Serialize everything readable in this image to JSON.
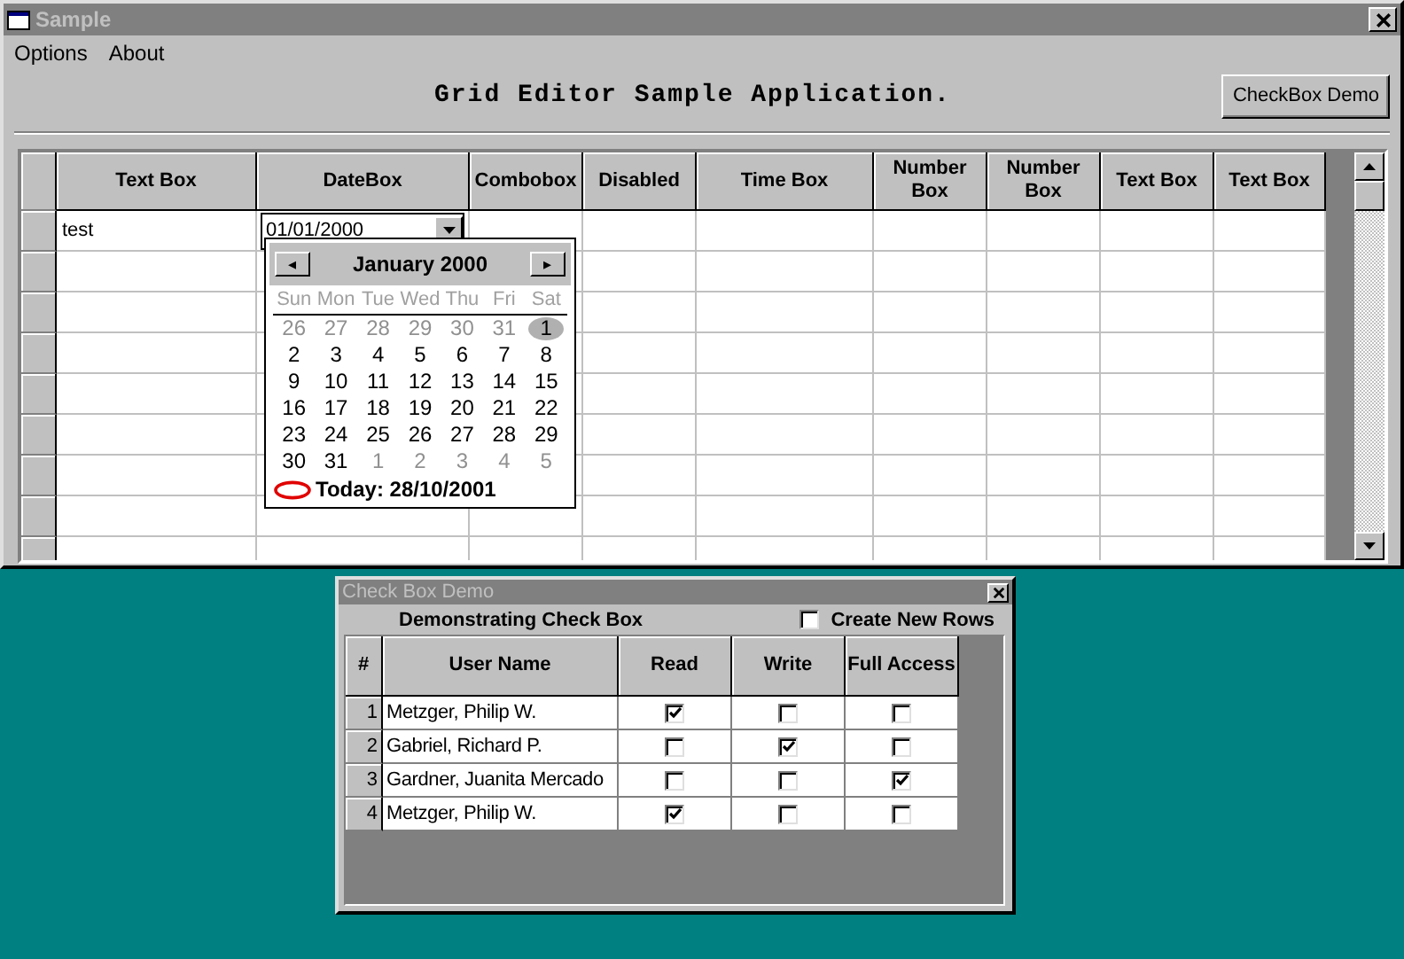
{
  "window": {
    "title": "Sample"
  },
  "menu": [
    {
      "label": "Options"
    },
    {
      "label": "About"
    }
  ],
  "heading": "Grid Editor Sample Application.",
  "checkbox_demo_button": "CheckBox Demo",
  "grid": {
    "columns": [
      "Text Box",
      "DateBox",
      "Combobox",
      "Disabled",
      "Time Box",
      "Number Box",
      "Number Box",
      "Text Box",
      "Text Box"
    ],
    "rows": [
      {
        "cells": [
          {
            "kind": "text",
            "value": "test"
          },
          {
            "kind": "date",
            "value": "01/01/2000"
          }
        ]
      }
    ]
  },
  "calendar": {
    "month": "January 2000",
    "prev": "◂",
    "next": "▸",
    "day_names": [
      "Sun",
      "Mon",
      "Tue",
      "Wed",
      "Thu",
      "Fri",
      "Sat"
    ],
    "weeks": [
      [
        {
          "day": "26",
          "muted": true,
          "selected": false
        },
        {
          "day": "27",
          "muted": true,
          "selected": false
        },
        {
          "day": "28",
          "muted": true,
          "selected": false
        },
        {
          "day": "29",
          "muted": true,
          "selected": false
        },
        {
          "day": "30",
          "muted": true,
          "selected": false
        },
        {
          "day": "31",
          "muted": true,
          "selected": false
        },
        {
          "day": "1",
          "muted": false,
          "selected": true
        }
      ],
      [
        {
          "day": "2",
          "muted": false,
          "selected": false
        },
        {
          "day": "3",
          "muted": false,
          "selected": false
        },
        {
          "day": "4",
          "muted": false,
          "selected": false
        },
        {
          "day": "5",
          "muted": false,
          "selected": false
        },
        {
          "day": "6",
          "muted": false,
          "selected": false
        },
        {
          "day": "7",
          "muted": false,
          "selected": false
        },
        {
          "day": "8",
          "muted": false,
          "selected": false
        }
      ],
      [
        {
          "day": "9",
          "muted": false,
          "selected": false
        },
        {
          "day": "10",
          "muted": false,
          "selected": false
        },
        {
          "day": "11",
          "muted": false,
          "selected": false
        },
        {
          "day": "12",
          "muted": false,
          "selected": false
        },
        {
          "day": "13",
          "muted": false,
          "selected": false
        },
        {
          "day": "14",
          "muted": false,
          "selected": false
        },
        {
          "day": "15",
          "muted": false,
          "selected": false
        }
      ],
      [
        {
          "day": "16",
          "muted": false,
          "selected": false
        },
        {
          "day": "17",
          "muted": false,
          "selected": false
        },
        {
          "day": "18",
          "muted": false,
          "selected": false
        },
        {
          "day": "19",
          "muted": false,
          "selected": false
        },
        {
          "day": "20",
          "muted": false,
          "selected": false
        },
        {
          "day": "21",
          "muted": false,
          "selected": false
        },
        {
          "day": "22",
          "muted": false,
          "selected": false
        }
      ],
      [
        {
          "day": "23",
          "muted": false,
          "selected": false
        },
        {
          "day": "24",
          "muted": false,
          "selected": false
        },
        {
          "day": "25",
          "muted": false,
          "selected": false
        },
        {
          "day": "26",
          "muted": false,
          "selected": false
        },
        {
          "day": "27",
          "muted": false,
          "selected": false
        },
        {
          "day": "28",
          "muted": false,
          "selected": false
        },
        {
          "day": "29",
          "muted": false,
          "selected": false
        }
      ],
      [
        {
          "day": "30",
          "muted": false,
          "selected": false
        },
        {
          "day": "31",
          "muted": false,
          "selected": false
        },
        {
          "day": "1",
          "muted": true,
          "selected": false
        },
        {
          "day": "2",
          "muted": true,
          "selected": false
        },
        {
          "day": "3",
          "muted": true,
          "selected": false
        },
        {
          "day": "4",
          "muted": true,
          "selected": false
        },
        {
          "day": "5",
          "muted": true,
          "selected": false
        }
      ]
    ],
    "today": "Today: 28/10/2001"
  },
  "dialog": {
    "title": "Check Box Demo",
    "heading": "Demonstrating Check Box",
    "create_new_rows": {
      "label": "Create New Rows",
      "checked": false
    },
    "columns": [
      "#",
      "User Name",
      "Read",
      "Write",
      "Full Access"
    ],
    "rows": [
      {
        "number": "1",
        "name": "Metzger, Philip W.",
        "read": true,
        "write": false,
        "full_access": false
      },
      {
        "number": "2",
        "name": "Gabriel, Richard P.",
        "read": false,
        "write": true,
        "full_access": false
      },
      {
        "number": "3",
        "name": "Gardner, Juanita Mercado",
        "read": false,
        "write": false,
        "full_access": true
      },
      {
        "number": "4",
        "name": "Metzger, Philip W.",
        "read": true,
        "write": false,
        "full_access": false
      }
    ]
  }
}
